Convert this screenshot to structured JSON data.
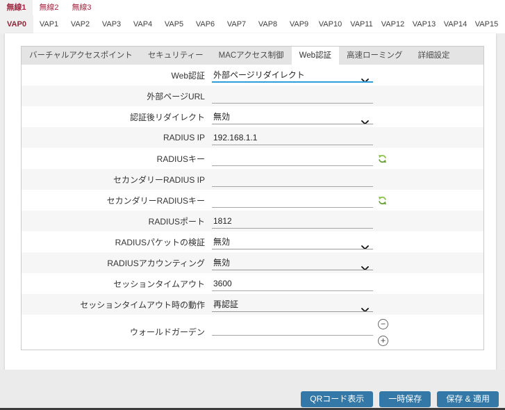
{
  "wireless_tabs": {
    "items": [
      {
        "label": "無線1",
        "active": true
      },
      {
        "label": "無線2",
        "active": false
      },
      {
        "label": "無線3",
        "active": false
      }
    ]
  },
  "vap_tabs": {
    "active": "VAP0",
    "items": [
      "VAP0",
      "VAP1",
      "VAP2",
      "VAP3",
      "VAP4",
      "VAP5",
      "VAP6",
      "VAP7",
      "VAP8",
      "VAP9",
      "VAP10",
      "VAP11",
      "VAP12",
      "VAP13",
      "VAP14",
      "VAP15"
    ]
  },
  "panel": {
    "tabs": [
      {
        "label": "バーチャルアクセスポイント",
        "active": false
      },
      {
        "label": "セキュリティー",
        "active": false
      },
      {
        "label": "MACアクセス制御",
        "active": false
      },
      {
        "label": "Web認証",
        "active": true
      },
      {
        "label": "高速ローミング",
        "active": false
      },
      {
        "label": "詳細設定",
        "active": false
      }
    ],
    "rows": [
      {
        "label": "Web認証",
        "type": "select",
        "value": "外部ページリダイレクト",
        "focus": true
      },
      {
        "label": "外部ページURL",
        "type": "input",
        "value": ""
      },
      {
        "label": "認証後リダイレクト",
        "type": "select",
        "value": "無効"
      },
      {
        "label": "RADIUS IP",
        "type": "input",
        "value": "192.168.1.1"
      },
      {
        "label": "RADIUSキー",
        "type": "input",
        "value": "",
        "icon": "refresh"
      },
      {
        "label": "セカンダリーRADIUS IP",
        "type": "input",
        "value": ""
      },
      {
        "label": "セカンダリーRADIUSキー",
        "type": "input",
        "value": "",
        "icon": "refresh"
      },
      {
        "label": "RADIUSポート",
        "type": "input",
        "value": "1812"
      },
      {
        "label": "RADIUSパケットの検証",
        "type": "select",
        "value": "無効"
      },
      {
        "label": "RADIUSアカウンティング",
        "type": "select",
        "value": "無効"
      },
      {
        "label": "セッションタイムアウト",
        "type": "input",
        "value": "3600"
      },
      {
        "label": "セッションタイムアウト時の動作",
        "type": "select",
        "value": "再認証"
      },
      {
        "label": "ウォールドガーデン",
        "type": "input",
        "value": "",
        "icon": "minus-plus"
      }
    ]
  },
  "footer": {
    "buttons": [
      {
        "label": "QRコード表示"
      },
      {
        "label": "一時保存"
      },
      {
        "label": "保存 & 適用"
      }
    ]
  },
  "colors": {
    "accent_red": "#a32440",
    "vap_active_red": "#8f2437",
    "focus_blue": "#2d9ddb",
    "button_blue": "#3478a8",
    "icon_green_light": "#8bc34a",
    "icon_green_dark": "#689f38"
  }
}
